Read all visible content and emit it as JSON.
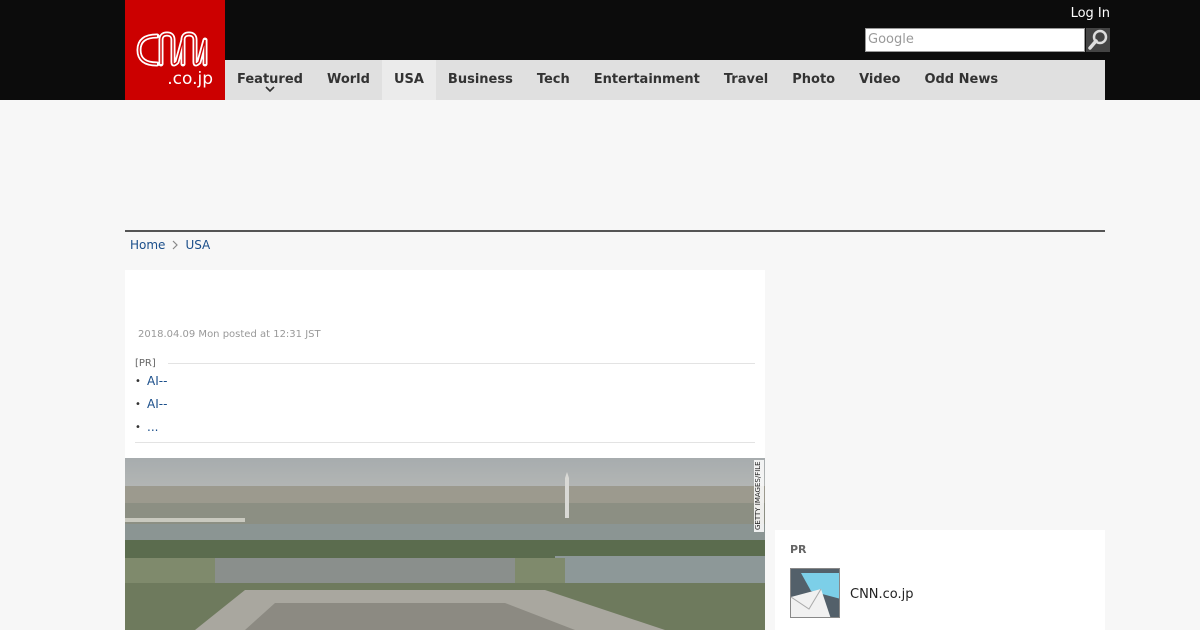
{
  "header": {
    "logo_text": "CNN",
    "logo_domain": ".co.jp",
    "login_label": "Log In",
    "search_placeholder": "Google"
  },
  "nav": {
    "items": [
      {
        "label": "Featured",
        "active": false
      },
      {
        "label": "World",
        "active": false
      },
      {
        "label": "USA",
        "active": true
      },
      {
        "label": "Business",
        "active": false
      },
      {
        "label": "Tech",
        "active": false
      },
      {
        "label": "Entertainment",
        "active": false
      },
      {
        "label": "Travel",
        "active": false
      },
      {
        "label": "Photo",
        "active": false
      },
      {
        "label": "Video",
        "active": false
      },
      {
        "label": "Odd News",
        "active": false
      }
    ]
  },
  "breadcrumb": {
    "home": "Home",
    "section": "USA"
  },
  "article": {
    "posted": "2018.04.09 Mon posted at 12:31 JST",
    "pr_label": "[PR]",
    "pr_links": [
      "AI--",
      "AI--",
      "..."
    ],
    "photo_credit": "GETTY IMAGES/FILE"
  },
  "sidebar": {
    "pr_title": "PR",
    "pr_item": "CNN.co.jp"
  },
  "colors": {
    "brand_red": "#cc0000",
    "header_bg": "#0c0c0c",
    "link_blue": "#1a4e8a"
  },
  "icons": {
    "search": "magnifier-icon",
    "chevron": "chevron-down-icon",
    "breadcrumb_sep": "chevron-right-icon"
  }
}
